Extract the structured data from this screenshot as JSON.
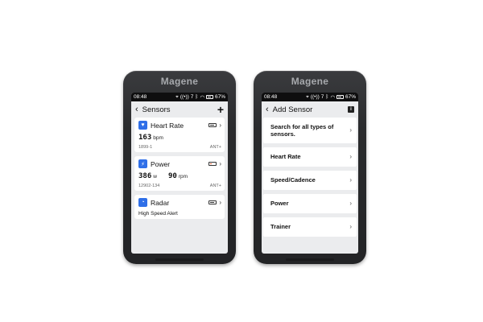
{
  "brand": "Magene",
  "status": {
    "time": "08:48",
    "signal_count": "7",
    "battery": "67%"
  },
  "left_screen": {
    "title": "Sensors",
    "sensors": [
      {
        "name": "Heart Rate",
        "readings": [
          {
            "value": "163",
            "unit": "bpm"
          }
        ],
        "id": "1899-1",
        "protocol": "ANT+",
        "battery_level": "high"
      },
      {
        "name": "Power",
        "readings": [
          {
            "value": "386",
            "unit": "w"
          },
          {
            "value": "90",
            "unit": "rpm"
          }
        ],
        "id": "12902-134",
        "protocol": "ANT+",
        "battery_level": "low"
      },
      {
        "name": "Radar",
        "alert": "High Speed Alert",
        "battery_level": "high"
      }
    ]
  },
  "right_screen": {
    "title": "Add Sensor",
    "items": [
      "Search for all types of sensors.",
      "Heart Rate",
      "Speed/Cadence",
      "Power",
      "Trainer"
    ]
  },
  "colors": {
    "accent_blue": "#2f6fe8",
    "screen_bg": "#ebecee",
    "low_battery": "#e25b2a"
  },
  "icons": [
    "back-icon",
    "plus-icon",
    "info-icon",
    "heart-icon",
    "power-icon",
    "radar-icon",
    "battery-icon",
    "chevron-right-icon",
    "location-icon",
    "signal-icon",
    "bluetooth-icon",
    "wifi-icon"
  ]
}
